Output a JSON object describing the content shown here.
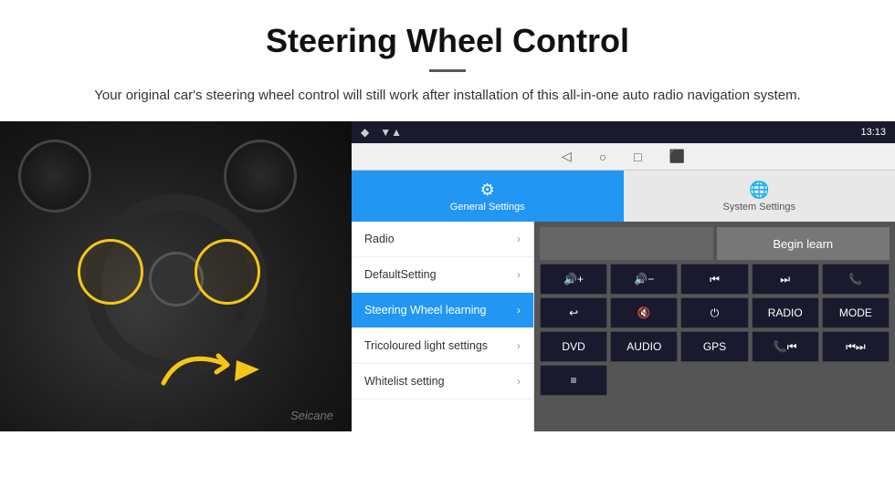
{
  "header": {
    "title": "Steering Wheel Control",
    "subtitle": "Your original car's steering wheel control will still work after installation of this all-in-one auto radio navigation system."
  },
  "android_ui": {
    "status_bar": {
      "time": "13:13",
      "signal_icon": "▼▲",
      "wifi_icon": "◆"
    },
    "nav_icons": [
      "◁",
      "○",
      "□",
      "⬛"
    ],
    "tabs": [
      {
        "label": "General Settings",
        "active": true
      },
      {
        "label": "System Settings",
        "active": false
      }
    ],
    "menu_items": [
      {
        "label": "Radio",
        "active": false
      },
      {
        "label": "DefaultSetting",
        "active": false
      },
      {
        "label": "Steering Wheel learning",
        "active": true
      },
      {
        "label": "Tricoloured light settings",
        "active": false
      },
      {
        "label": "Whitelist setting",
        "active": false
      }
    ],
    "begin_learn_label": "Begin learn",
    "grid_buttons_row1": [
      {
        "label": "🔊+",
        "icon": true
      },
      {
        "label": "🔊−",
        "icon": true
      },
      {
        "label": "⏮",
        "icon": true
      },
      {
        "label": "⏭",
        "icon": true
      },
      {
        "label": "📞",
        "icon": true
      }
    ],
    "grid_buttons_row2": [
      {
        "label": "↩",
        "icon": true
      },
      {
        "label": "🔇",
        "icon": true
      },
      {
        "label": "⏻",
        "icon": true
      },
      {
        "label": "RADIO",
        "icon": false
      },
      {
        "label": "MODE",
        "icon": false
      }
    ],
    "grid_buttons_row3": [
      {
        "label": "DVD",
        "icon": false
      },
      {
        "label": "AUDIO",
        "icon": false
      },
      {
        "label": "GPS",
        "icon": false
      },
      {
        "label": "📞⏮",
        "icon": true
      },
      {
        "label": "⏮⏭",
        "icon": true
      }
    ],
    "grid_buttons_row4": [
      {
        "label": "≡",
        "icon": true
      }
    ]
  },
  "watermark": "Seicane"
}
